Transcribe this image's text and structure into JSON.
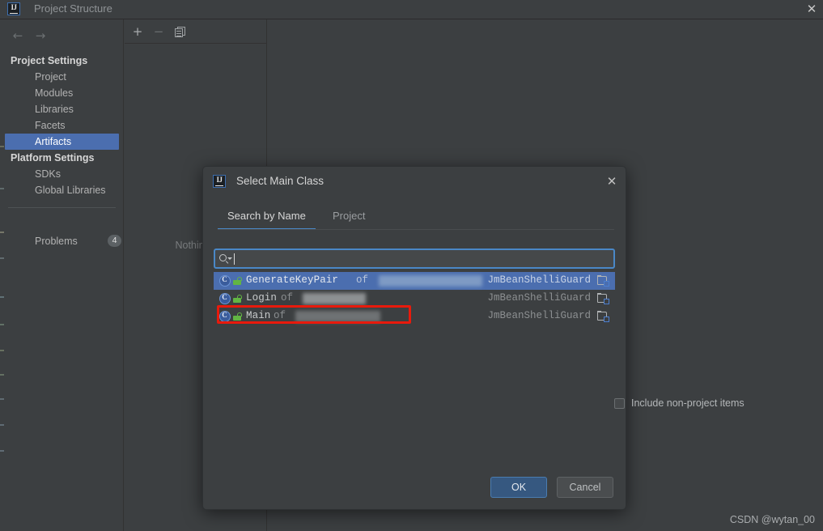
{
  "window": {
    "title": "Project Structure",
    "close_label": "✕",
    "logo_text": "IJ"
  },
  "sidebar": {
    "nav": {
      "back": "←",
      "forward": "→"
    },
    "sections": [
      {
        "group": "Project Settings",
        "items": [
          {
            "label": "Project",
            "selected": false
          },
          {
            "label": "Modules",
            "selected": false
          },
          {
            "label": "Libraries",
            "selected": false
          },
          {
            "label": "Facets",
            "selected": false
          },
          {
            "label": "Artifacts",
            "selected": true
          }
        ]
      },
      {
        "group": "Platform Settings",
        "items": [
          {
            "label": "SDKs",
            "selected": false
          },
          {
            "label": "Global Libraries",
            "selected": false
          }
        ]
      }
    ],
    "problems": {
      "label": "Problems",
      "count": "4"
    }
  },
  "midpane": {
    "toolbar": {
      "add": "+",
      "remove": "−",
      "copy": "copy-icon"
    },
    "empty_text": "Nothing t"
  },
  "dialog": {
    "title": "Select Main Class",
    "logo_text": "IJ",
    "close_label": "✕",
    "tabs": [
      {
        "label": "Search by Name",
        "active": true
      },
      {
        "label": "Project",
        "active": false
      }
    ],
    "include_non_project": {
      "label": "Include non-project items",
      "checked": false
    },
    "search": {
      "value": "",
      "placeholder": ""
    },
    "results": [
      {
        "name": "GenerateKeyPair",
        "of": "of",
        "package_redacted": true,
        "package_width": 128,
        "module": "JmBeanShelliGuard",
        "selected": true,
        "annotated": false
      },
      {
        "name": "Login",
        "of": "of",
        "package_redacted": true,
        "package_width": 78,
        "module": "JmBeanShelliGuard",
        "selected": false,
        "annotated": false
      },
      {
        "name": "Main",
        "of": "of",
        "package_redacted": true,
        "package_width": 105,
        "module": "JmBeanShelliGuard",
        "selected": false,
        "annotated": true
      }
    ],
    "buttons": {
      "ok": "OK",
      "cancel": "Cancel"
    }
  },
  "watermark": "CSDN @wytan_00",
  "colors": {
    "background": "#3c3f41",
    "selection": "#4b6eaf",
    "accent": "#4a88c7",
    "ok_button": "#365880",
    "annotation": "#e81a0c",
    "public_icon": "#62b543"
  }
}
